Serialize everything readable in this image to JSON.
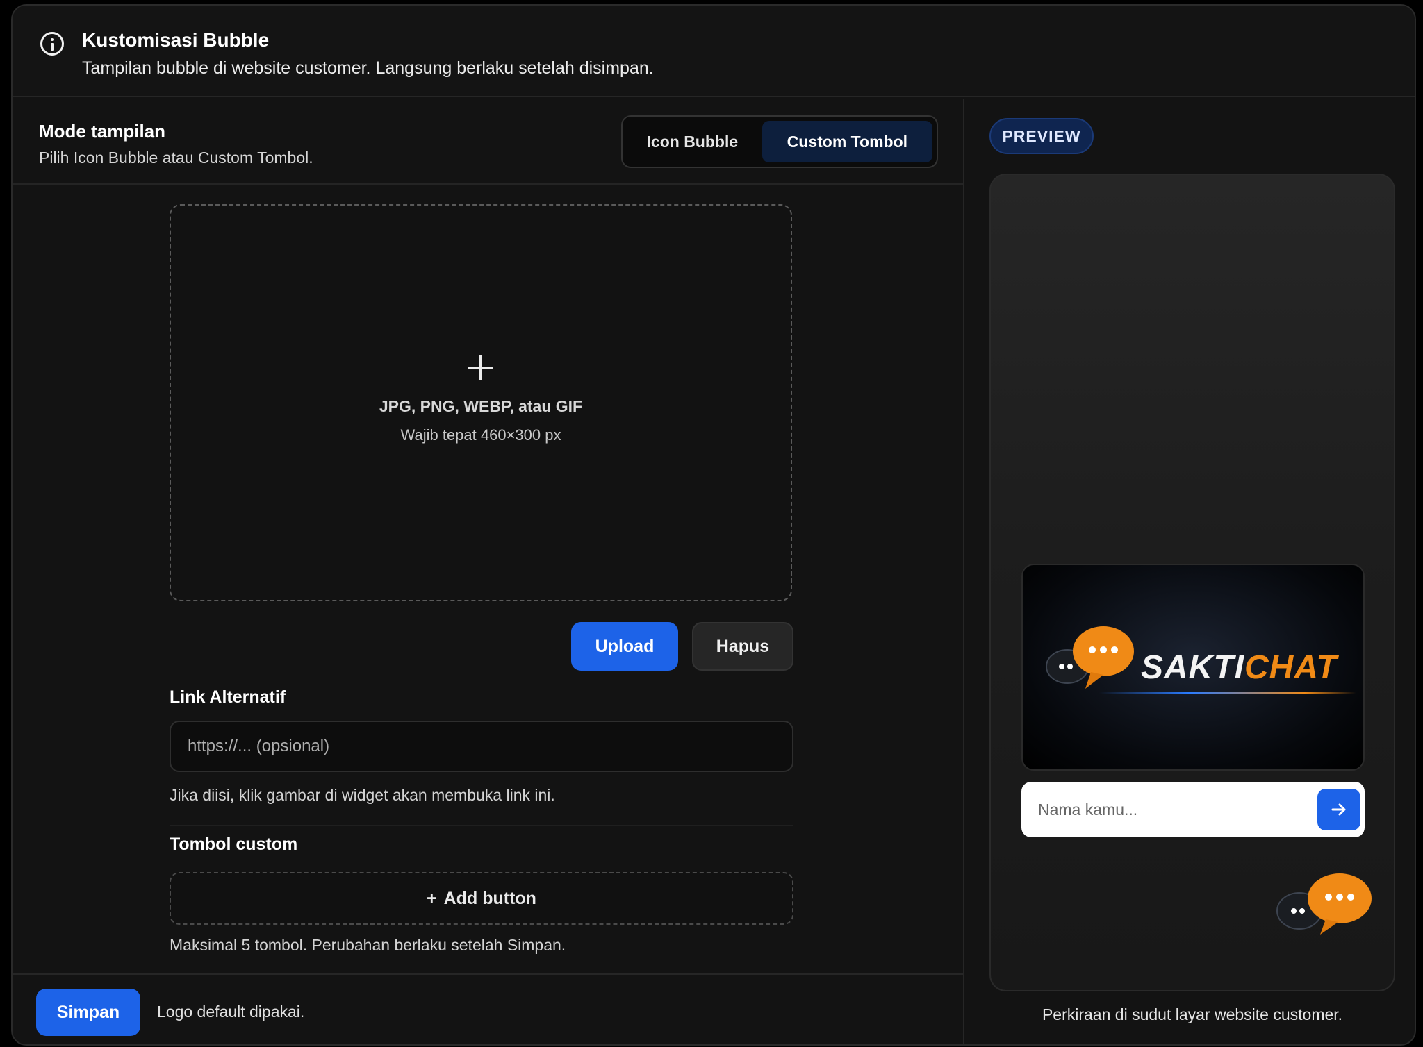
{
  "header": {
    "title": "Kustomisasi Bubble",
    "subtitle": "Tampilan bubble di website customer. Langsung berlaku setelah disimpan."
  },
  "mode": {
    "label": "Mode tampilan",
    "description": "Pilih Icon Bubble atau Custom Tombol.",
    "options": [
      "Icon Bubble",
      "Custom Tombol"
    ],
    "selected": "Custom Tombol"
  },
  "dropzone": {
    "formats": "JPG, PNG, WEBP, atau GIF",
    "size_hint": "Wajib tepat 460×300 px"
  },
  "actions": {
    "upload_label": "Upload",
    "hapus_label": "Hapus"
  },
  "link": {
    "label": "Link Alternatif",
    "placeholder": "https://... (opsional)",
    "value": "",
    "help": "Jika diisi, klik gambar di widget akan membuka link ini."
  },
  "custom_buttons": {
    "label": "Tombol custom",
    "add_label": "Add button",
    "add_prefix": "+",
    "help": "Maksimal 5 tombol. Perubahan berlaku setelah Simpan."
  },
  "footer": {
    "save_label": "Simpan",
    "status": "Logo default dipakai."
  },
  "preview": {
    "badge": "PREVIEW",
    "brand_part1": "SAKTI",
    "brand_part2": "CHAT",
    "name_placeholder": "Nama kamu...",
    "caption": "Perkiraan di sudut layar website customer."
  },
  "colors": {
    "accent": "#1d63e8",
    "brand_orange": "#f08a16",
    "background": "#131313",
    "segment_active": "#0d1f3d"
  },
  "icons": {
    "info": "info-icon",
    "plus": "plus-icon",
    "send": "arrow-right-icon",
    "chat": "chat-bubble-icon"
  }
}
